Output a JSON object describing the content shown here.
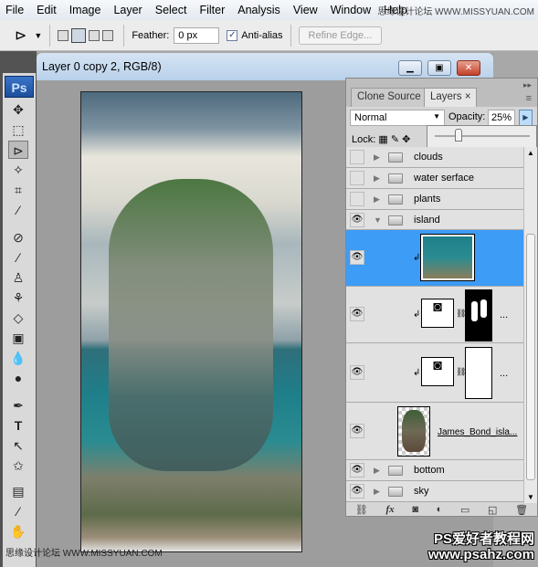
{
  "menu": [
    "File",
    "Edit",
    "Image",
    "Layer",
    "Select",
    "Filter",
    "Analysis",
    "View",
    "Window",
    "Help"
  ],
  "watermark_top": "思缘设计论坛 WWW.MISSYUAN.COM",
  "options": {
    "feather_label": "Feather:",
    "feather_value": "0 px",
    "antialias_label": "Anti-alias",
    "antialias_checked": true,
    "refine_label": "Refine Edge..."
  },
  "tools": {
    "logo": "Ps"
  },
  "document": {
    "title": "Layer 0 copy 2, RGB/8)"
  },
  "panel": {
    "tabs": [
      "Clone Source",
      "Layers"
    ],
    "blend_mode": "Normal",
    "opacity_label": "Opacity:",
    "opacity_value": "25%",
    "lock_label": "Lock:",
    "layers": [
      {
        "name": "clouds",
        "visible": false,
        "type": "group"
      },
      {
        "name": "water serface",
        "visible": false,
        "type": "group"
      },
      {
        "name": "plants",
        "visible": false,
        "type": "group"
      },
      {
        "name": "island",
        "visible": true,
        "type": "group",
        "expanded": true
      },
      {
        "name": "",
        "visible": true,
        "type": "layer",
        "selected": true
      },
      {
        "name": "",
        "visible": true,
        "type": "adjustment-mask"
      },
      {
        "name": "",
        "visible": true,
        "type": "adjustment-mask"
      },
      {
        "name": "James_Bond_isla...",
        "visible": true,
        "type": "layer"
      },
      {
        "name": "bottom",
        "visible": true,
        "type": "group"
      },
      {
        "name": "sky",
        "visible": true,
        "type": "group"
      }
    ],
    "selected_color": "#3d9cf5"
  },
  "watermark_bottom": {
    "line1": "PS爱好者教程网",
    "line2": "www.psahz.com",
    "left": "思缘设计论坛 WWW.MISSYUAN.COM"
  }
}
